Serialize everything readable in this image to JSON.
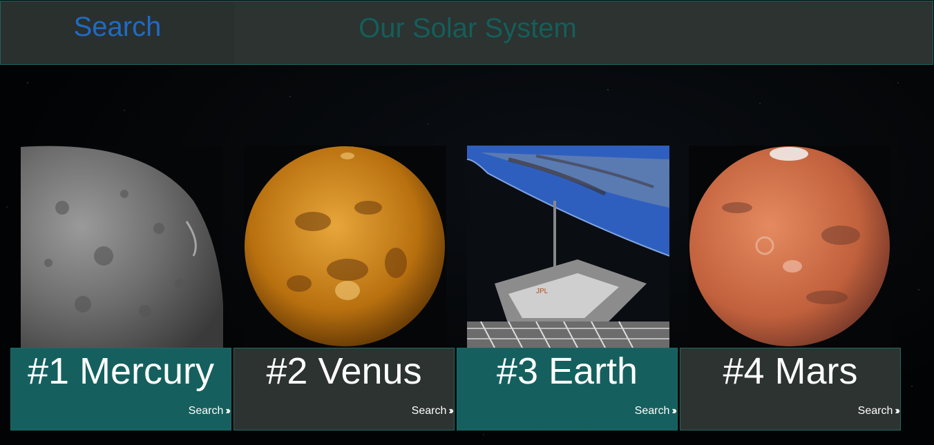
{
  "header": {
    "search_label": "Search",
    "title": "Our Solar System"
  },
  "planets": [
    {
      "title": "#1 Mercury",
      "link_label": "Search",
      "image": "mercury-image",
      "card_color": "#15605e"
    },
    {
      "title": "#2 Venus",
      "link_label": "Search",
      "image": "venus-image",
      "card_color": "#2c3330"
    },
    {
      "title": "#3 Earth",
      "link_label": "Search",
      "image": "earth-image",
      "card_color": "#15605e"
    },
    {
      "title": "#4 Mars",
      "link_label": "Search",
      "image": "mars-image",
      "card_color": "#2c3330"
    }
  ],
  "colors": {
    "header_bg": "#2c3330",
    "accent_teal": "#15605e",
    "search_blue": "#1f6bc4",
    "title_teal": "#155e5a"
  }
}
